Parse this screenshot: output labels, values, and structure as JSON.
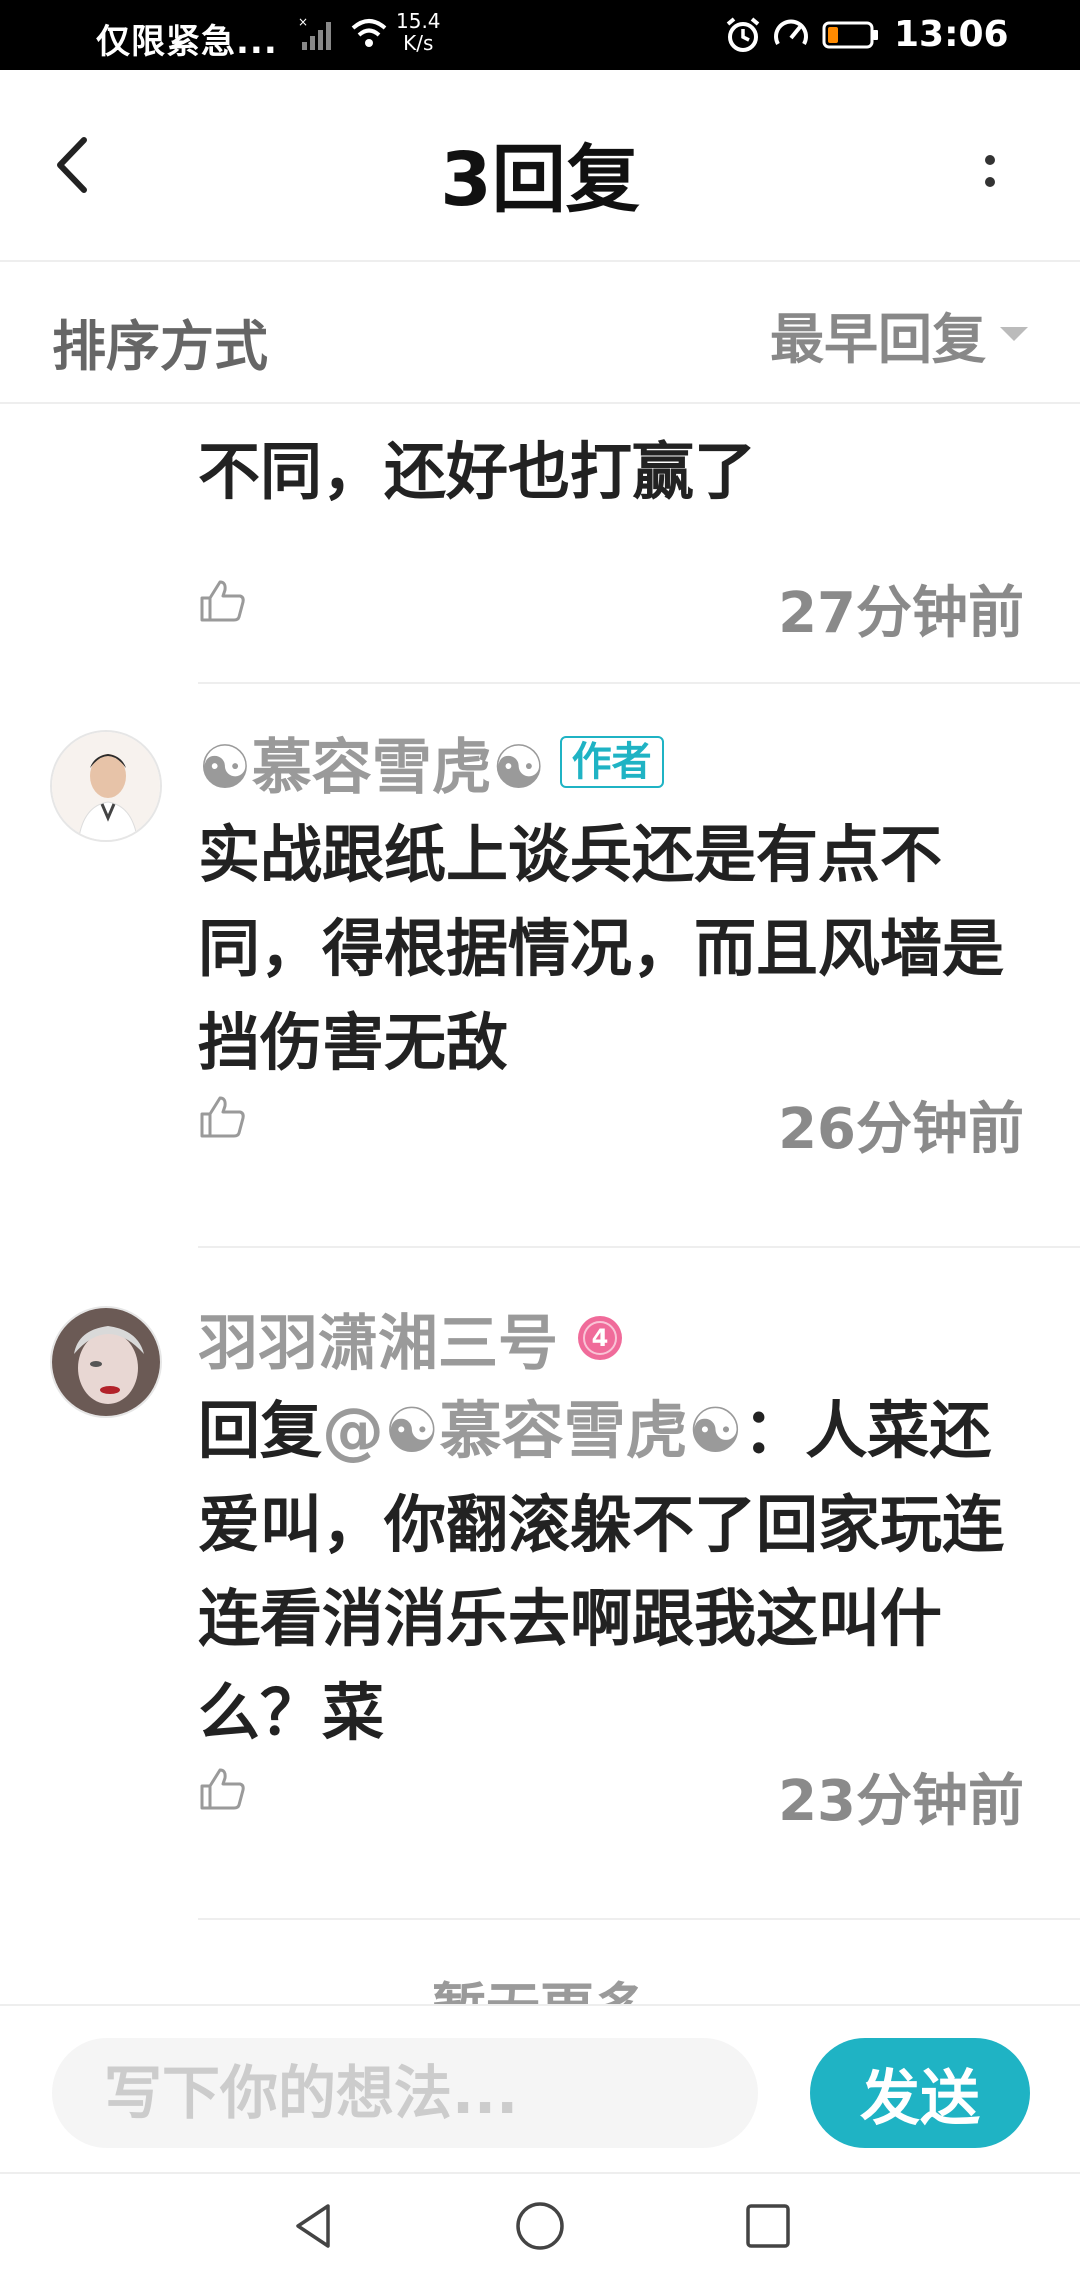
{
  "status_bar": {
    "left_text": "仅限紧急...",
    "net_speed_value": "15.4",
    "net_speed_unit": "K/s",
    "time": "13:06",
    "battery_color": "#ff8a00"
  },
  "header": {
    "title": "3回复"
  },
  "sort": {
    "label": "排序方式",
    "value": "最早回复"
  },
  "partial_comment": {
    "text": "不同，还好也打赢了",
    "time": "27分钟前"
  },
  "comments": [
    {
      "name": "☯慕容雪虎☯",
      "badge": "作者",
      "body": "实战跟纸上谈兵还是有点不同，得根据情况，而且风墙是挡伤害无敌",
      "time": "26分钟前"
    },
    {
      "name": "羽羽潇湘三号",
      "level": "4",
      "reply_prefix": "回复",
      "mention": "@☯慕容雪虎☯",
      "body": "：人菜还爱叫，你翻滚躲不了回家玩连连看消消乐去啊跟我这叫什么？菜",
      "time": "23分钟前"
    }
  ],
  "more_hint": "暂无更多",
  "input": {
    "placeholder": "写下你的想法...",
    "send_label": "发送"
  },
  "colors": {
    "accent": "#1fb3c4",
    "level_badge": "#f06b9a"
  }
}
